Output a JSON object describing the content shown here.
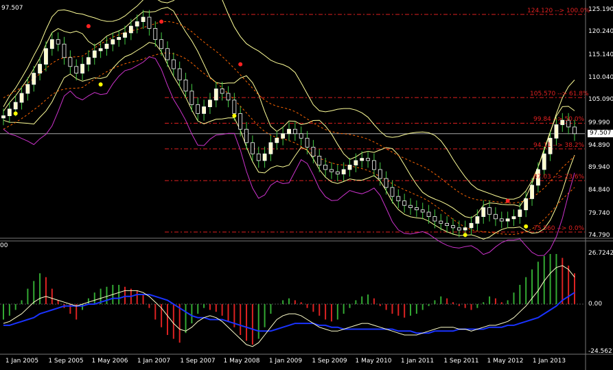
{
  "window": {
    "current_price_label": "97.507",
    "sub_corner_label": "00"
  },
  "colors": {
    "background": "#000000",
    "bull_candle": "#ffffcc",
    "bear_candle": "#ffffff",
    "wick": "#44cc44",
    "fibo": "#e02020",
    "bollinger": "#ffff99",
    "envelope": "#ff6600",
    "magenta_band": "#cc33cc",
    "fractal_up": "#ff2222",
    "fractal_down": "#ffff00",
    "macd_signal": "#1a33ff",
    "macd_line": "#ffffcc",
    "hist_up": "#33aa33",
    "hist_down": "#dd2222",
    "price_line": "#aaaaaa"
  },
  "chart_data": [
    {
      "type": "candlestick",
      "y_ticks": [
        "125.190",
        "120.240",
        "115.140",
        "110.040",
        "105.090",
        "99.990",
        "94.890",
        "89.940",
        "84.840",
        "79.740",
        "74.790"
      ],
      "ylim": [
        74.79,
        125.19
      ],
      "x_ticks": [
        "1 Jan 2005",
        "1 Sep 2005",
        "1 May 2006",
        "1 Jan 2007",
        "1 Sep 2007",
        "1 May 2008",
        "1 Jan 2009",
        "1 Sep 2009",
        "1 May 2010",
        "1 Jan 2011",
        "1 Sep 2011",
        "1 May 2012",
        "1 Jan 2013"
      ],
      "current_price": 97.507,
      "fibonacci_levels": [
        {
          "price": 124.12,
          "label": "124.120 --> 100.0%"
        },
        {
          "price": 105.57,
          "label": "105.570 --> 61.8%"
        },
        {
          "price": 99.84,
          "label": "99.84 --> 50.0%"
        },
        {
          "price": 94.11,
          "label": "94.11 --> 38.2%"
        },
        {
          "price": 87.03,
          "label": "87.03 --> 23.6%"
        },
        {
          "price": 75.56,
          "label": "75.560 --> 0.0%"
        }
      ],
      "close_series": [
        101.5,
        103.0,
        104.5,
        106.5,
        108.5,
        111.0,
        113.0,
        116.5,
        118.5,
        117.5,
        114.5,
        112.5,
        111.0,
        113.0,
        114.5,
        116.0,
        116.5,
        117.5,
        118.5,
        119.0,
        120.0,
        121.5,
        122.5,
        123.5,
        121.0,
        118.5,
        116.5,
        114.0,
        112.0,
        109.5,
        107.0,
        104.0,
        102.0,
        103.5,
        105.0,
        107.5,
        106.5,
        105.0,
        102.0,
        98.5,
        95.5,
        93.0,
        91.5,
        93.0,
        95.5,
        96.5,
        97.5,
        98.5,
        97.5,
        96.5,
        94.5,
        92.5,
        90.5,
        89.5,
        89.0,
        88.5,
        89.5,
        90.5,
        91.5,
        92.0,
        91.5,
        89.5,
        87.5,
        85.5,
        83.5,
        82.5,
        81.5,
        81.0,
        80.5,
        80.0,
        79.0,
        78.0,
        77.5,
        77.0,
        76.5,
        76.0,
        76.5,
        77.5,
        79.0,
        81.0,
        79.5,
        78.5,
        78.0,
        78.5,
        79.0,
        80.5,
        83.0,
        86.0,
        89.5,
        93.0,
        96.5,
        99.5,
        100.5,
        99.0,
        97.5
      ]
    },
    {
      "type": "macd",
      "y_ticks": [
        "26.7242",
        "0.00",
        "-24.5621"
      ],
      "ylim": [
        -24.5621,
        26.7242
      ],
      "histogram": [
        -8,
        -6,
        -3,
        2,
        8,
        12,
        16,
        14,
        8,
        2,
        -2,
        -5,
        -8,
        -3,
        3,
        6,
        8,
        9,
        10,
        10,
        9,
        8,
        7,
        5,
        -2,
        -8,
        -12,
        -16,
        -18,
        -20,
        -15,
        -10,
        -5,
        -2,
        -3,
        -4,
        -6,
        -9,
        -12,
        -16,
        -19,
        -21,
        -18,
        -12,
        -5,
        0,
        2,
        3,
        2,
        1,
        -2,
        -4,
        -6,
        -8,
        -9,
        -8,
        -5,
        -2,
        2,
        4,
        5,
        3,
        -1,
        -3,
        -5,
        -6,
        -7,
        -6,
        -5,
        -3,
        -1,
        2,
        4,
        3,
        1,
        -1,
        -2,
        -3,
        -2,
        1,
        4,
        3,
        1,
        2,
        6,
        10,
        14,
        18,
        22,
        25,
        26,
        26,
        24,
        20,
        16
      ],
      "macd_line": [
        -10,
        -9,
        -7,
        -5,
        -2,
        1,
        3,
        4,
        3,
        2,
        1,
        0,
        -1,
        0,
        1,
        2,
        3,
        4,
        5,
        6,
        7,
        7,
        7,
        6,
        4,
        1,
        -2,
        -6,
        -10,
        -13,
        -14,
        -12,
        -9,
        -7,
        -6,
        -7,
        -9,
        -12,
        -15,
        -18,
        -21,
        -22,
        -20,
        -16,
        -12,
        -8,
        -6,
        -5,
        -5,
        -6,
        -8,
        -10,
        -12,
        -13,
        -14,
        -14,
        -13,
        -12,
        -11,
        -10,
        -10,
        -11,
        -12,
        -13,
        -14,
        -15,
        -16,
        -16,
        -16,
        -15,
        -14,
        -13,
        -12,
        -12,
        -12,
        -13,
        -13,
        -14,
        -13,
        -12,
        -11,
        -11,
        -10,
        -9,
        -7,
        -4,
        -1,
        3,
        7,
        12,
        16,
        19,
        20,
        18,
        14
      ],
      "signal_line": [
        -11,
        -11,
        -10,
        -9,
        -8,
        -7,
        -5,
        -4,
        -3,
        -2,
        -1,
        -1,
        -1,
        -1,
        0,
        0,
        1,
        2,
        3,
        3,
        4,
        4,
        5,
        5,
        5,
        4,
        3,
        2,
        0,
        -2,
        -4,
        -6,
        -7,
        -7,
        -8,
        -8,
        -8,
        -9,
        -10,
        -11,
        -12,
        -13,
        -14,
        -14,
        -14,
        -13,
        -12,
        -11,
        -10,
        -10,
        -10,
        -10,
        -11,
        -11,
        -12,
        -12,
        -13,
        -13,
        -13,
        -13,
        -13,
        -13,
        -13,
        -13,
        -13,
        -14,
        -14,
        -14,
        -15,
        -15,
        -15,
        -14,
        -14,
        -14,
        -14,
        -13,
        -13,
        -13,
        -13,
        -13,
        -12,
        -12,
        -12,
        -11,
        -11,
        -10,
        -9,
        -8,
        -7,
        -5,
        -3,
        -1,
        2,
        4,
        6
      ]
    }
  ]
}
